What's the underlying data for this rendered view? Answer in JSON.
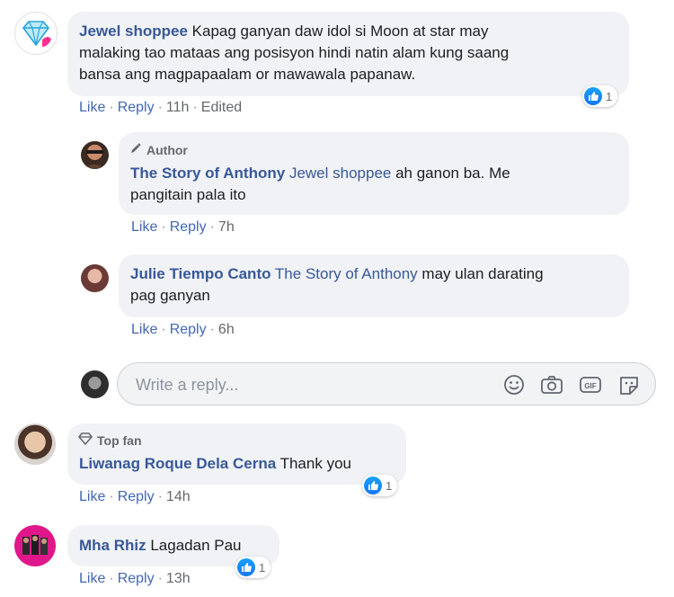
{
  "comments": [
    {
      "author": "Jewel shoppee",
      "text": "Kapag ganyan daw idol si Moon at star may malaking tao mataas ang posisyon hindi natin alam kung saang bansa ang magpapaalam or mawawala papanaw.",
      "line1": "Kapag ganyan daw idol si Moon at star may",
      "line2": "malaking tao mataas ang posisyon hindi natin alam kung saang",
      "line3": "bansa ang magpapaalam or mawawala papanaw.",
      "like": "Like",
      "reply": "Reply",
      "time": "11h",
      "edited": "Edited",
      "reaction_count": "1"
    },
    {
      "badge": "Author",
      "author": "The Story of Anthony",
      "mention": "Jewel shoppee",
      "text_line1": "ah ganon ba. Me",
      "text_line2": "pangitain pala ito",
      "like": "Like",
      "reply": "Reply",
      "time": "7h"
    },
    {
      "author": "Julie Tiempo Canto",
      "mention": "The Story of Anthony",
      "text_line1": "may ulan darating",
      "text_line2": "pag ganyan",
      "like": "Like",
      "reply": "Reply",
      "time": "6h"
    },
    {
      "badge": "Top fan",
      "author": "Liwanag Roque Dela Cerna",
      "text": "Thank you",
      "like": "Like",
      "reply": "Reply",
      "time": "14h",
      "reaction_count": "1"
    },
    {
      "author": "Mha Rhiz",
      "text": "Lagadan Pau",
      "like": "Like",
      "reply": "Reply",
      "time": "13h",
      "reaction_count": "1"
    }
  ],
  "reply_box": {
    "placeholder": "Write a reply...",
    "icons": [
      "emoji-icon",
      "camera-icon",
      "gif-icon",
      "sticker-icon"
    ]
  },
  "colors": {
    "name": "#385898",
    "action_link": "#4267b2",
    "bubble": "#f0f2f5",
    "like_blue": "#1877f2"
  }
}
